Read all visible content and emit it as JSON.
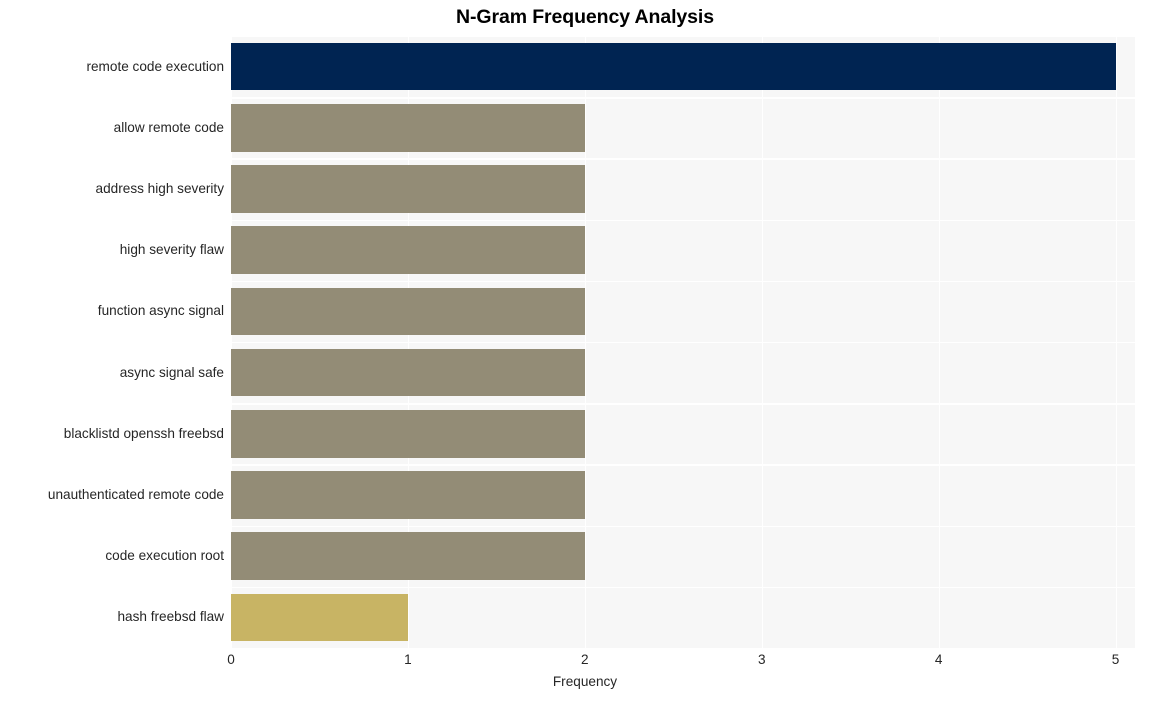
{
  "chart_data": {
    "type": "bar",
    "orientation": "horizontal",
    "title": "N-Gram Frequency Analysis",
    "xlabel": "Frequency",
    "ylabel": "",
    "categories": [
      "remote code execution",
      "allow remote code",
      "address high severity",
      "high severity flaw",
      "function async signal",
      "async signal safe",
      "blacklistd openssh freebsd",
      "unauthenticated remote code",
      "code execution root",
      "hash freebsd flaw"
    ],
    "values": [
      5,
      2,
      2,
      2,
      2,
      2,
      2,
      2,
      2,
      1
    ],
    "bar_colors": [
      "#002452",
      "#938c76",
      "#938c76",
      "#938c76",
      "#938c76",
      "#938c76",
      "#938c76",
      "#938c76",
      "#938c76",
      "#c8b464"
    ],
    "xticks": [
      "0",
      "1",
      "2",
      "3",
      "4",
      "5"
    ],
    "xtick_values": [
      0,
      1,
      2,
      3,
      4,
      5
    ],
    "xlim": [
      0,
      5.11
    ],
    "grid": true,
    "grid_color": "#ffffff",
    "plot_background": "#f7f7f7",
    "figure_background": "#ffffff",
    "legend": null
  }
}
